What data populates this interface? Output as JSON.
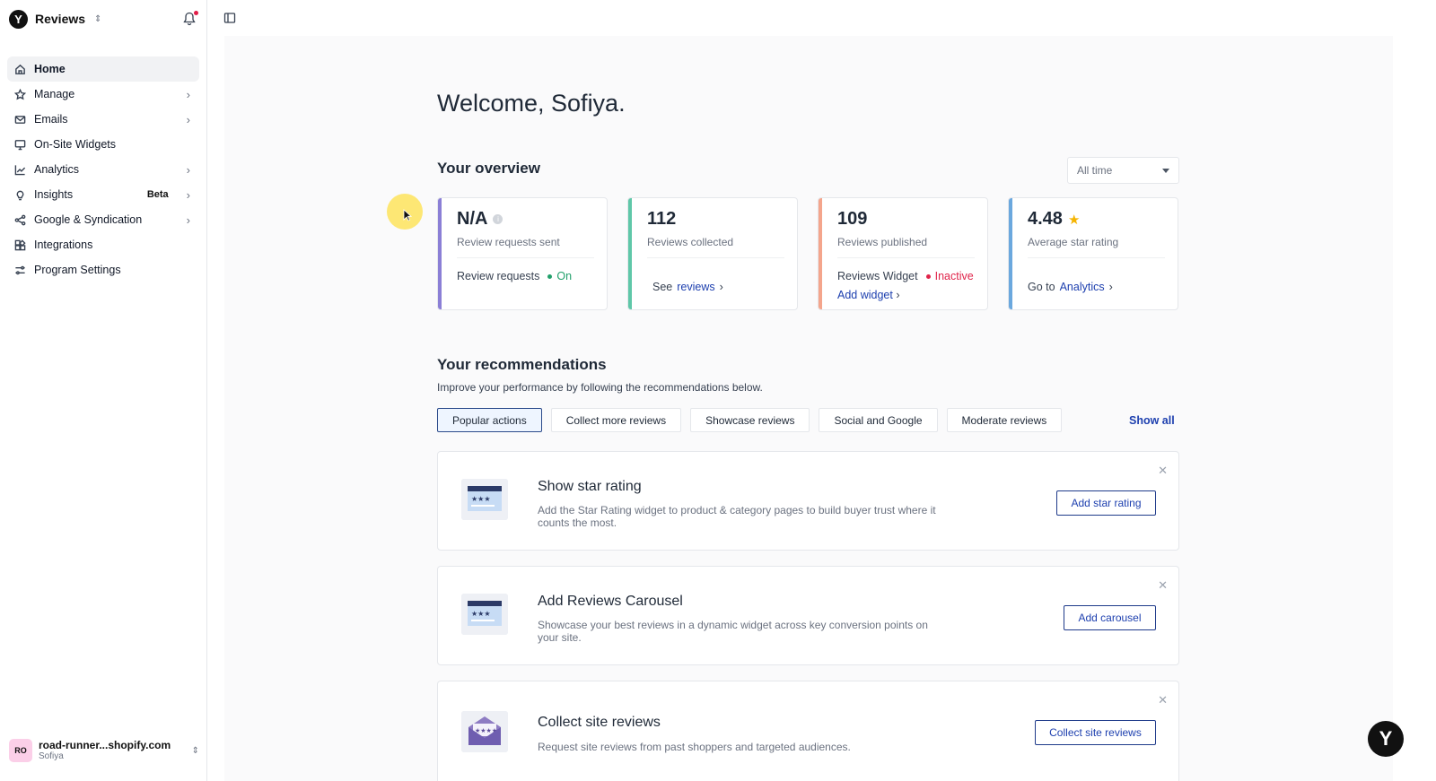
{
  "brand": {
    "title": "Reviews",
    "logo_letter": "Y"
  },
  "nav": [
    {
      "label": "Home",
      "icon": "home-icon",
      "active": true
    },
    {
      "label": "Manage",
      "icon": "star-icon",
      "chevron": true
    },
    {
      "label": "Emails",
      "icon": "mail-icon",
      "chevron": true
    },
    {
      "label": "On-Site Widgets",
      "icon": "monitor-icon"
    },
    {
      "label": "Analytics",
      "icon": "chart-icon",
      "chevron": true
    },
    {
      "label": "Insights",
      "icon": "bulb-icon",
      "badge": "Beta",
      "chevron": true
    },
    {
      "label": "Google & Syndication",
      "icon": "share-icon",
      "chevron": true
    },
    {
      "label": "Integrations",
      "icon": "integrations-icon"
    },
    {
      "label": "Program Settings",
      "icon": "settings-icon"
    }
  ],
  "account": {
    "initials": "RO",
    "domain": "road-runner...shopify.com",
    "user": "Sofiya"
  },
  "main": {
    "welcome": "Welcome, Sofiya.",
    "overview_title": "Your overview",
    "timeframe": "All time",
    "cards": [
      {
        "value": "N/A",
        "label": "Review requests sent",
        "line1_text": "Review requests",
        "line1_status": "On",
        "color": "#8b7fd6",
        "status_color": "#22a06b"
      },
      {
        "value": "112",
        "label": "Reviews collected",
        "line1_text": "See",
        "line1_link": "reviews",
        "color": "#5fc7a8"
      },
      {
        "value": "109",
        "label": "Reviews published",
        "line1_text": "Reviews Widget",
        "line1_status": "Inactive",
        "line2_link": "Add widget",
        "color": "#f4a58c",
        "status_color": "#e0244a"
      },
      {
        "value": "4.48",
        "label": "Average star rating",
        "line1_text": "Go to",
        "line1_link": "Analytics",
        "color": "#6ba8de"
      }
    ],
    "rec_title": "Your recommendations",
    "rec_desc": "Improve your performance by following the recommendations below.",
    "tabs": [
      "Popular actions",
      "Collect more reviews",
      "Showcase reviews",
      "Social and Google",
      "Moderate reviews"
    ],
    "show_all": "Show all",
    "recommendations": [
      {
        "title": "Show star rating",
        "text": "Add the Star Rating widget to product & category pages to build buyer trust where it counts the most.",
        "button": "Add star rating"
      },
      {
        "title": "Add Reviews Carousel",
        "text": "Showcase your best reviews in a dynamic widget across key conversion points on your site.",
        "button": "Add carousel"
      },
      {
        "title": "Collect site reviews",
        "text": "Request site reviews from past shoppers and targeted audiences.",
        "button": "Collect site reviews"
      }
    ]
  },
  "colors": {
    "accent": "#1e40af",
    "star": "#f5b400"
  }
}
